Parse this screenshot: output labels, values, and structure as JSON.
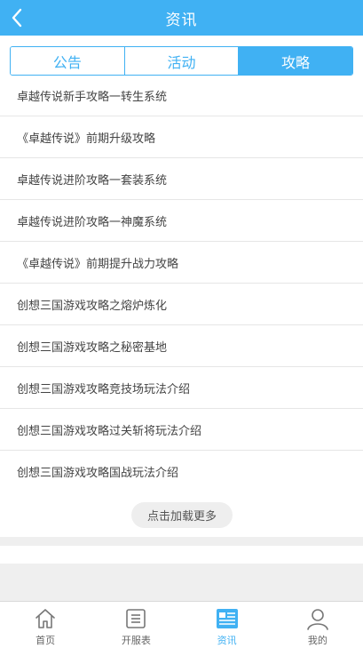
{
  "header": {
    "title": "资讯"
  },
  "tabs": [
    {
      "label": "公告",
      "active": false
    },
    {
      "label": "活动",
      "active": false
    },
    {
      "label": "攻略",
      "active": true
    }
  ],
  "articles": [
    "卓越传说新手攻略一转生系统",
    "《卓越传说》前期升级攻略",
    "卓越传说进阶攻略一套装系统",
    "卓越传说进阶攻略一神魔系统",
    "《卓越传说》前期提升战力攻略",
    "创想三国游戏攻略之熔炉炼化",
    "创想三国游戏攻略之秘密基地",
    "创想三国游戏攻略竞技场玩法介绍",
    "创想三国游戏攻略过关斩将玩法介绍",
    "创想三国游戏攻略国战玩法介绍"
  ],
  "load_more": "点击加载更多",
  "bottom_nav": [
    {
      "label": "首页",
      "icon": "home-icon",
      "active": false
    },
    {
      "label": "开服表",
      "icon": "server-list-icon",
      "active": false
    },
    {
      "label": "资讯",
      "icon": "news-icon",
      "active": true
    },
    {
      "label": "我的",
      "icon": "user-icon",
      "active": false
    }
  ],
  "colors": {
    "accent": "#40b1f3",
    "nav_inactive": "#666666"
  }
}
